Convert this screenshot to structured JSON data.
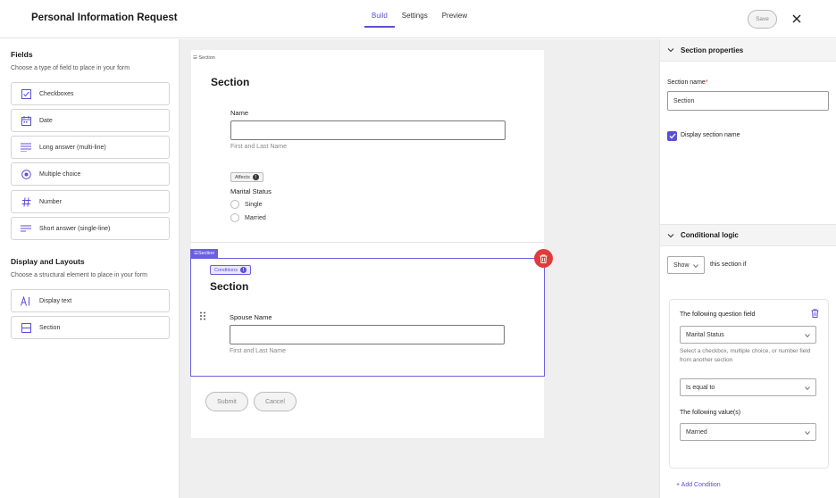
{
  "header": {
    "title": "Personal Information Request",
    "tabs": [
      "Build",
      "Settings",
      "Preview"
    ],
    "active_tab": "Build",
    "save_label": "Save",
    "close_icon": "close-icon"
  },
  "fields_panel": {
    "heading": "Fields",
    "subheading": "Choose a type of field to place in your form",
    "items": [
      {
        "label": "Checkboxes",
        "icon": "checkbox-icon"
      },
      {
        "label": "Date",
        "icon": "calendar-icon"
      },
      {
        "label": "Long answer (multi-line)",
        "icon": "lines-icon"
      },
      {
        "label": "Multiple choice",
        "icon": "radio-icon"
      },
      {
        "label": "Number",
        "icon": "hash-icon"
      },
      {
        "label": "Short answer (single-line)",
        "icon": "short-lines-icon"
      }
    ],
    "layout_heading": "Display and Layouts",
    "layout_subheading": "Choose a structural element to place in your form",
    "layout_items": [
      {
        "label": "Display text",
        "icon": "text-icon"
      },
      {
        "label": "Section",
        "icon": "section-icon"
      }
    ]
  },
  "form": {
    "section1": {
      "tag": "Section",
      "title": "Section",
      "name_label": "Name",
      "name_help": "First and Last Name",
      "affects_badge": "Affects",
      "marital_label": "Marital Status",
      "options": [
        "Single",
        "Married"
      ]
    },
    "section2": {
      "tag": "Section",
      "conditions_badge": "Conditions",
      "title": "Section",
      "spouse_label": "Spouse Name",
      "spouse_help": "First and Last Name"
    },
    "submit_label": "Submit",
    "cancel_label": "Cancel"
  },
  "properties": {
    "section_header": "Section properties",
    "section_name_label": "Section name",
    "required_mark": "*",
    "section_name_value": "Section",
    "display_name_label": "Display section name",
    "display_name_checked": true,
    "logic_header": "Conditional logic",
    "show_value": "Show",
    "this_section_if": "this section if",
    "question_field_label": "The following question field",
    "question_field_value": "Marital Status",
    "question_help": "Select a checkbox, multiple choice, or number field from another section",
    "operator_value": "Is equal to",
    "value_label": "The following value(s)",
    "value_value": "Married",
    "add_condition": "+ Add Condition"
  },
  "colors": {
    "accent": "#5b4fd6",
    "danger": "#e03b3b"
  }
}
